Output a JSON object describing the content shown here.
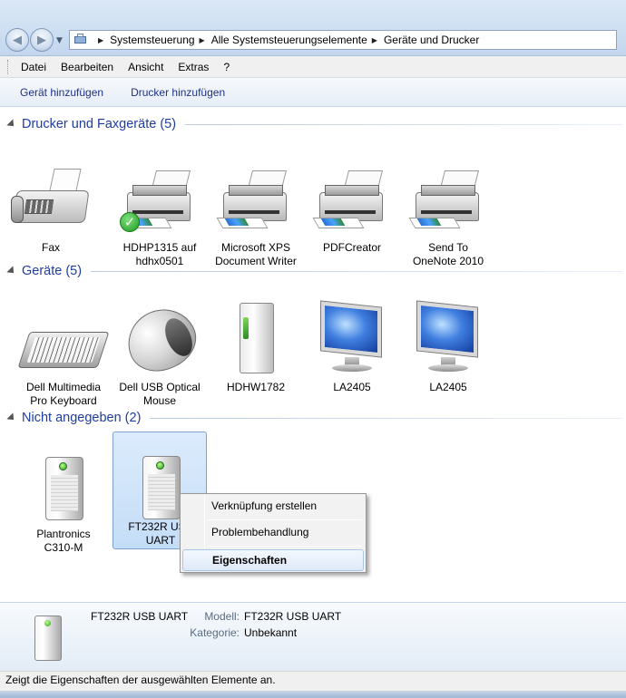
{
  "address": {
    "crumbs": [
      "Systemsteuerung",
      "Alle Systemsteuerungselemente",
      "Geräte und Drucker"
    ]
  },
  "menu": [
    "Datei",
    "Bearbeiten",
    "Ansicht",
    "Extras",
    "?"
  ],
  "commands": [
    "Gerät hinzufügen",
    "Drucker hinzufügen"
  ],
  "groups": {
    "printers": {
      "title": "Drucker und Faxgeräte (5)",
      "items": [
        {
          "label": "Fax",
          "icon": "fax-icon"
        },
        {
          "label": "HDHP1315 auf\nhdhx0501",
          "icon": "printer-icon",
          "default": true
        },
        {
          "label": "Microsoft XPS\nDocument Writer",
          "icon": "printer-icon"
        },
        {
          "label": "PDFCreator",
          "icon": "printer-icon"
        },
        {
          "label": "Send To\nOneNote 2010",
          "icon": "printer-icon"
        }
      ]
    },
    "devices": {
      "title": "Geräte (5)",
      "items": [
        {
          "label": "Dell Multimedia\nPro Keyboard",
          "icon": "keyboard-icon"
        },
        {
          "label": "Dell USB Optical\nMouse",
          "icon": "mouse-icon"
        },
        {
          "label": "HDHW1782",
          "icon": "external-drive-icon"
        },
        {
          "label": "LA2405",
          "icon": "monitor-icon"
        },
        {
          "label": "LA2405",
          "icon": "monitor-icon"
        }
      ]
    },
    "unspecified": {
      "title": "Nicht angegeben (2)",
      "items": [
        {
          "label": "Plantronics\nC310-M",
          "icon": "generic-device-icon"
        },
        {
          "label": "FT232R USB\nUART",
          "icon": "generic-device-icon",
          "selected": true
        }
      ]
    }
  },
  "context_menu": {
    "items": [
      "Verknüpfung erstellen",
      "Problembehandlung",
      "Eigenschaften"
    ],
    "highlighted": "Eigenschaften"
  },
  "details": {
    "name": "FT232R USB UART",
    "model_label": "Modell:",
    "model_value": "FT232R USB UART",
    "category_label": "Kategorie:",
    "category_value": "Unbekannt"
  },
  "status": "Zeigt die Eigenschaften der ausgewählten Elemente an.",
  "colors": {
    "link": "#1e3287",
    "group_title": "#1e3da0",
    "selection": "#c4ddf7"
  }
}
